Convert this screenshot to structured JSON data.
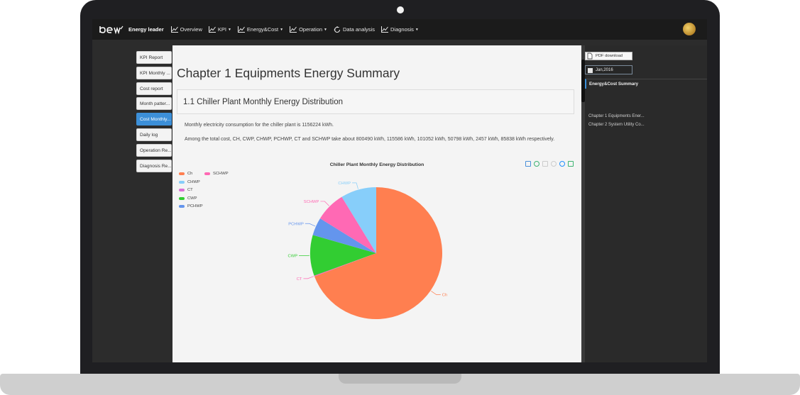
{
  "nav": {
    "brand": "Energy leader",
    "items": [
      {
        "label": "Overview",
        "icon": "line-chart-icon",
        "dropdown": false
      },
      {
        "label": "KPI",
        "icon": "line-chart-icon",
        "dropdown": true
      },
      {
        "label": "Energy&Cost",
        "icon": "line-chart-icon",
        "dropdown": true
      },
      {
        "label": "Operation",
        "icon": "line-chart-icon",
        "dropdown": true
      },
      {
        "label": "Data analysis",
        "icon": "refresh-icon",
        "dropdown": false
      },
      {
        "label": "Diagnosis",
        "icon": "line-chart-icon",
        "dropdown": true
      }
    ],
    "caret": "▼"
  },
  "subnav": {
    "items": [
      {
        "label": "KPI Report",
        "active": false
      },
      {
        "label": "KPI Monthly ...",
        "active": false
      },
      {
        "label": "Cost report",
        "active": false
      },
      {
        "label": "Month patter...",
        "active": false
      },
      {
        "label": "Cost Monthly...",
        "active": true
      },
      {
        "label": "Daily log",
        "active": false
      },
      {
        "label": "Operation Re...",
        "active": false
      },
      {
        "label": "Diagnosis Re...",
        "active": false
      }
    ]
  },
  "document": {
    "title": "Chapter 1 Equipments Energy Summary",
    "section_title": "1.1 Chiller Plant Monthly Energy Distribution",
    "paragraph1": "Monthly electricity consumption for the chiller plant is 1156224 kWh.",
    "paragraph2": "Among the total cost, CH, CWP, CHWP, PCHWP, CT and SCHWP take about 800490 kWh, 115586 kWh, 101052 kWh, 50798 kWh, 2457 kWh, 85838 kWh respectively."
  },
  "chart_data": {
    "type": "pie",
    "title": "Chiller Plant Monthly Energy Distribution",
    "legend": [
      "Ch",
      "SCHWP",
      "CHWP",
      "CT",
      "CWP",
      "PCHWP"
    ],
    "slices": [
      {
        "name": "Ch",
        "value": 800490,
        "color": "#ff7f50"
      },
      {
        "name": "CT",
        "value": 2457,
        "color": "#ff69b4"
      },
      {
        "name": "CWP",
        "value": 115586,
        "color": "#32cd32"
      },
      {
        "name": "PCHWP",
        "value": 50798,
        "color": "#6495ed"
      },
      {
        "name": "SCHWP",
        "value": 85838,
        "color": "#ff69b4"
      },
      {
        "name": "CHWP",
        "value": 101052,
        "color": "#87cefa"
      }
    ],
    "legend_colors": {
      "Ch": "#ff7f50",
      "SCHWP": "#ff69b4",
      "CHWP": "#87cefa",
      "CT": "#da70d6",
      "CWP": "#32cd32",
      "PCHWP": "#6495ed"
    },
    "legend_placement": "top-left",
    "toolbox_icons": [
      "data-view-icon",
      "zoom-icon",
      "zoom-reset-icon",
      "restore-icon",
      "save-image-icon"
    ]
  },
  "rightpanel": {
    "pdf_label": "PDF download",
    "date_label": "Jan,2016",
    "toc_head": "Energy&Cost Summary",
    "toc_items": [
      "Chapter 1 Equipments Ener...",
      "Chapter 2 System Utility Co..."
    ]
  },
  "colors": {
    "accent": "#3c8fd8",
    "nav_bg": "#1b1b1b",
    "doc_bg": "#f4f4f4"
  }
}
